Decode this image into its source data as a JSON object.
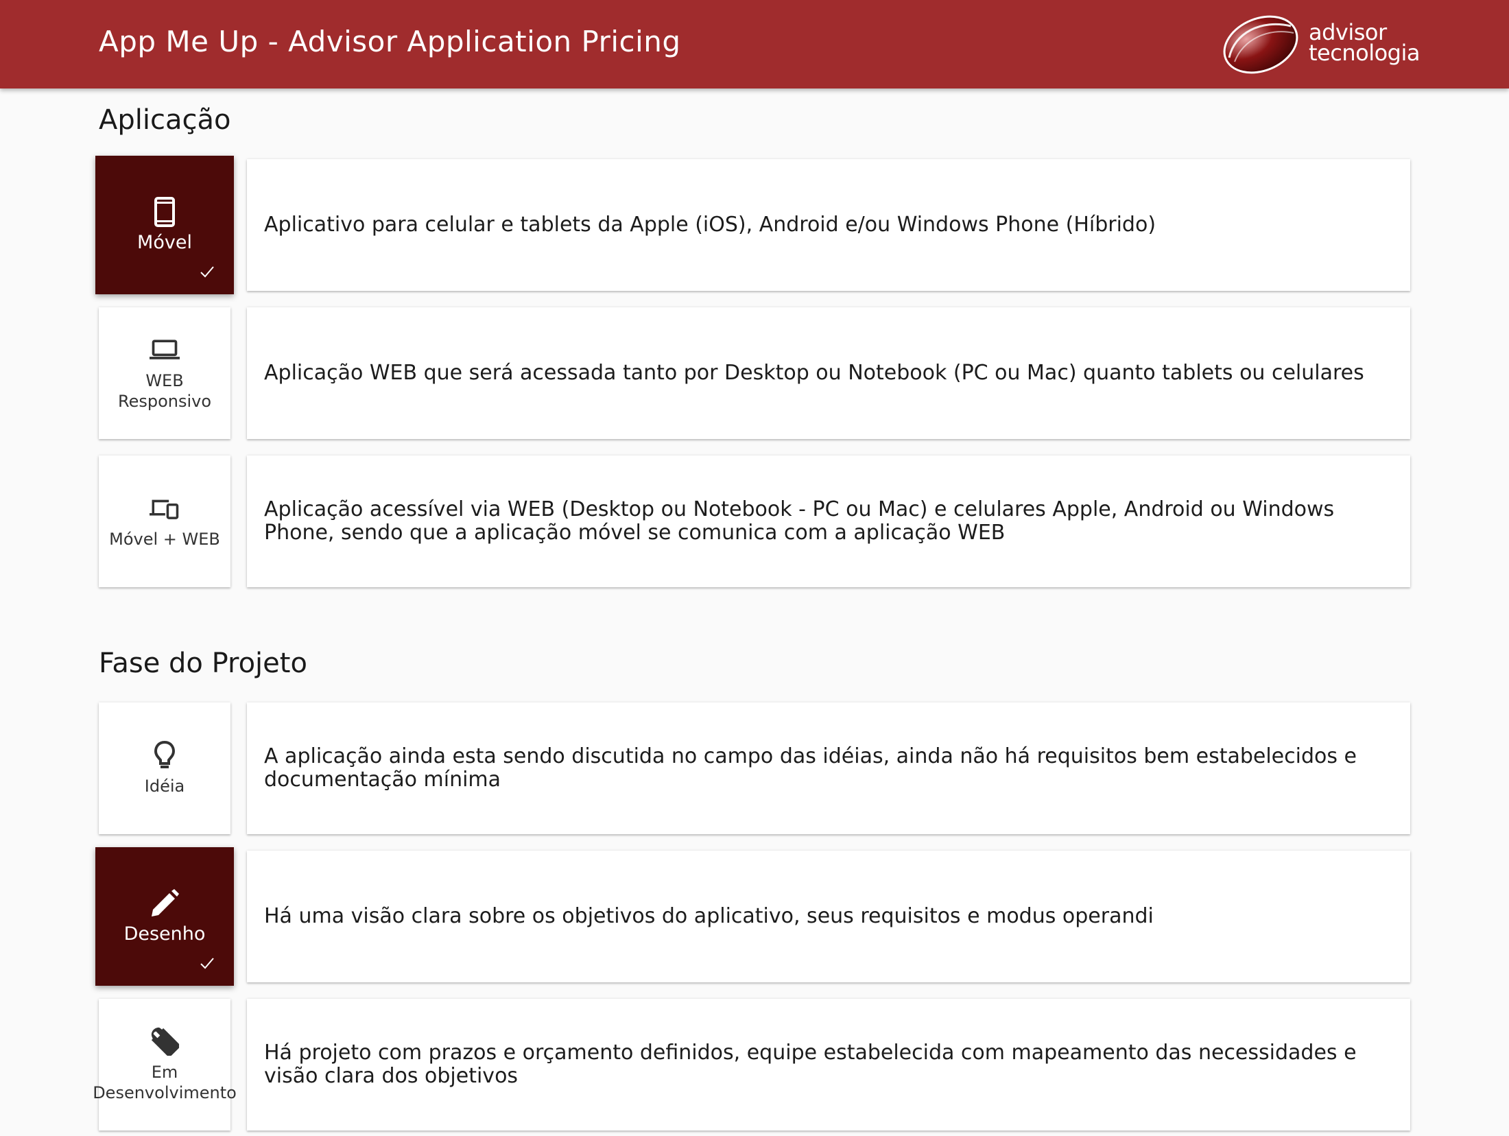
{
  "header": {
    "title": "App Me Up - Advisor Application Pricing",
    "brand_line1": "advisor",
    "brand_line2": "tecnologia",
    "bg_color": "#a02c2d"
  },
  "sections": [
    {
      "title": "Aplicação",
      "options": [
        {
          "label": "Móvel",
          "icon": "smartphone-icon",
          "selected": true,
          "description": "Aplicativo para celular e tablets da Apple (iOS), Android e/ou Windows Phone (Híbrido)"
        },
        {
          "label": "WEB Responsivo",
          "icon": "laptop-icon",
          "selected": false,
          "description": "Aplicação WEB que será acessada tanto por Desktop ou Notebook (PC ou Mac) quanto tablets ou celulares"
        },
        {
          "label": "Móvel + WEB",
          "icon": "devices-icon",
          "selected": false,
          "description": "Aplicação acessível via WEB (Desktop ou Notebook - PC ou Mac) e celulares Apple, Android ou Windows Phone, sendo que a aplicação móvel se comunica com a aplicação WEB"
        }
      ]
    },
    {
      "title": "Fase do Projeto",
      "options": [
        {
          "label": "Idéia",
          "icon": "lightbulb-icon",
          "selected": false,
          "description": "A aplicação ainda esta sendo discutida no campo das idéias, ainda não há requisitos bem estabelecidos e documentação mínima"
        },
        {
          "label": "Desenho",
          "icon": "pencil-icon",
          "selected": true,
          "description": "Há uma visão clara sobre os objetivos do aplicativo, seus requisitos e modus operandi"
        },
        {
          "label": "Em Desenvolvimento",
          "icon": "wrench-icon",
          "selected": false,
          "description": "Há projeto com prazos e orçamento definidos, equipe estabelecida com mapeamento das necessidades e visão clara dos objetivos"
        }
      ]
    }
  ],
  "colors": {
    "selected_tile": "#4c0a09",
    "page_bg": "#fafafa"
  }
}
